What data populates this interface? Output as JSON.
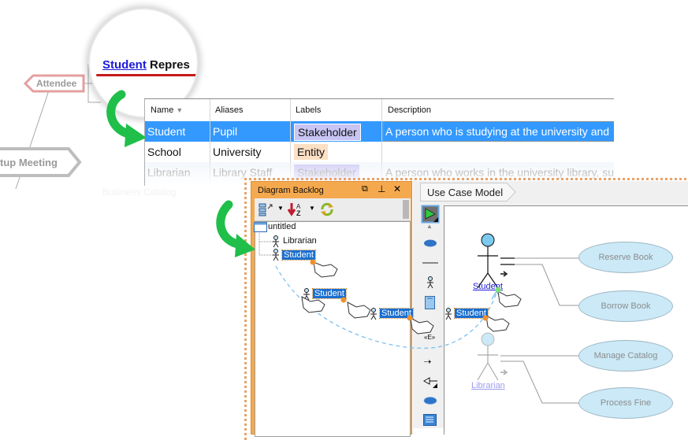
{
  "mindmap": {
    "attendee_label": "Attendee",
    "meeting_label": "tup Meeting",
    "faded_label": "Business Catalog"
  },
  "magnifier": {
    "link_text": "Student",
    "rest_text": "Repres"
  },
  "model_table": {
    "columns": [
      {
        "label": "Name",
        "sort_icon": "sort-desc-icon"
      },
      {
        "label": "Aliases"
      },
      {
        "label": "Labels"
      },
      {
        "label": "Description"
      }
    ],
    "rows": [
      {
        "name": "Student",
        "alias": "Pupil",
        "label": "Stakeholder",
        "label_color": "#c8c4f4",
        "description": "A person who is studying at the university and",
        "selected": true
      },
      {
        "name": "School",
        "alias": "University",
        "label": "Entity",
        "label_color": "#fde0c4",
        "description": "",
        "selected": false
      },
      {
        "name": "Librarian",
        "alias": "Library Staff",
        "label": "Stakeholder",
        "label_color": "#c8c4f4",
        "description": "A person who works in the university library, su",
        "selected": false
      }
    ]
  },
  "backlog": {
    "title": "Diagram Backlog",
    "tree": {
      "root": "untitled",
      "children": [
        "Librarian",
        "Student"
      ]
    },
    "dragging_label": "Student"
  },
  "diagram": {
    "breadcrumb": "Use Case Model",
    "actors": [
      {
        "name": "Student",
        "active": true
      },
      {
        "name": "Librarian",
        "active": false
      }
    ],
    "use_cases": [
      "Reserve Book",
      "Borrow Book",
      "Manage Catalog",
      "Process Fine"
    ]
  },
  "colors": {
    "selection_blue": "#3399ff",
    "tree_selection": "#1a6fd0",
    "accent_orange": "#f5a94e",
    "arrow_green": "#1fbf4a",
    "usecase_fill": "#cbe9f7"
  }
}
